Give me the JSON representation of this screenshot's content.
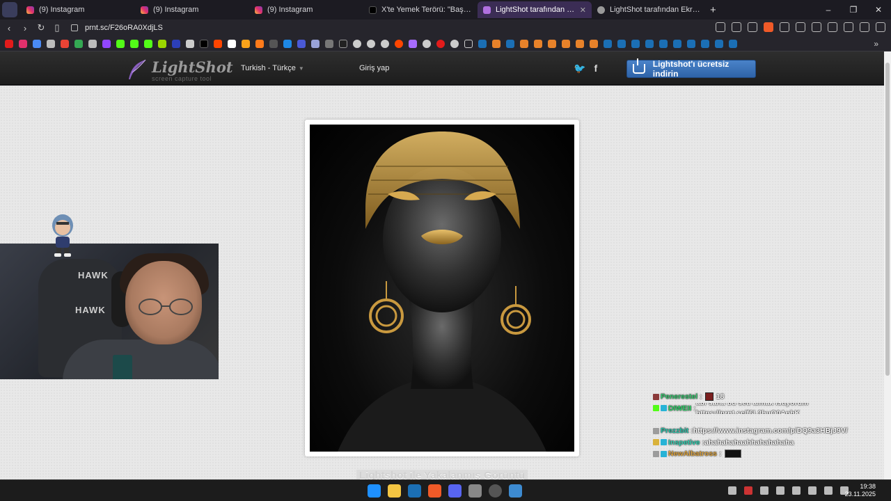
{
  "browser": {
    "tabs": [
      {
        "title": "(9) Instagram",
        "favicon": "instagram-icon",
        "active": false
      },
      {
        "title": "(9) Instagram",
        "favicon": "instagram-icon",
        "active": false
      },
      {
        "title": "(9) Instagram",
        "favicon": "instagram-icon",
        "active": false
      },
      {
        "title": "X'te Yemek Terörü: \"Başakşehir'de Bu",
        "favicon": "x-icon",
        "active": false
      },
      {
        "title": "LightShot tarafından Ekran Görüntüsü",
        "favicon": "lightshot-icon",
        "active": true
      },
      {
        "title": "LightShot tarafından Ekran Görüntüsü",
        "favicon": "globe-icon",
        "active": false
      }
    ],
    "close_glyph": "✕",
    "new_tab": "+",
    "window_controls": [
      "–",
      "❐",
      "✕"
    ],
    "url": "prnt.sc/F26oRA0XdjLS",
    "more_bookmarks": "»"
  },
  "lightshot": {
    "logo_text": "LightShot",
    "logo_subtitle": "screen capture tool",
    "language": "Turkish - Türkçe",
    "login": "Giriş yap",
    "social": [
      "twitter-icon",
      "facebook-icon"
    ],
    "twitter_glyph": "🐦",
    "facebook_glyph": "f",
    "download_label": "Lightshot'ı ücretsiz indirin",
    "caption": "Lightshot ile Yakalanmış Görüntü"
  },
  "webcam": {
    "chair_brand": "HAWK"
  },
  "chat": [
    {
      "user": "Penerestel",
      "separator": " : ",
      "message": "18",
      "user_color": "#37c86f",
      "badges": [
        "#8b3a3a"
      ]
    },
    {
      "user": "DIWEII",
      "separator": " : ",
      "message": "abi sana bu seti almak istiyorum https://prnt.sc/f6L3huQ0ApbK",
      "user_color": "#2fd36a",
      "badges": [
        "#53fc18",
        "#27b3d6"
      ]
    },
    {
      "user": "Prezzbit",
      "separator": " : ",
      "message": "https://www.instagram.com/p/DQ9a3HBjJ9V/",
      "user_color": "#29c1a8",
      "badges": [
        "#9c9c9c"
      ]
    },
    {
      "user": "Inspetive",
      "separator": " : ",
      "message": "ahahahahaahhahahahaha",
      "user_color": "#35d7b8",
      "badges": [
        "#d9b23a",
        "#27b3d6"
      ]
    },
    {
      "user": "NewAlbatross",
      "separator": " : ",
      "message": "",
      "user_color": "#e0a640",
      "badges": [
        "#9c9c9c",
        "#27b3d6"
      ]
    }
  ],
  "taskbar": {
    "time": "19:38",
    "date": "23.11.2025"
  },
  "colors": {
    "download_button": "#3a73b8",
    "active_tab": "#3b2d55",
    "brave_accent": "#f05a28"
  }
}
